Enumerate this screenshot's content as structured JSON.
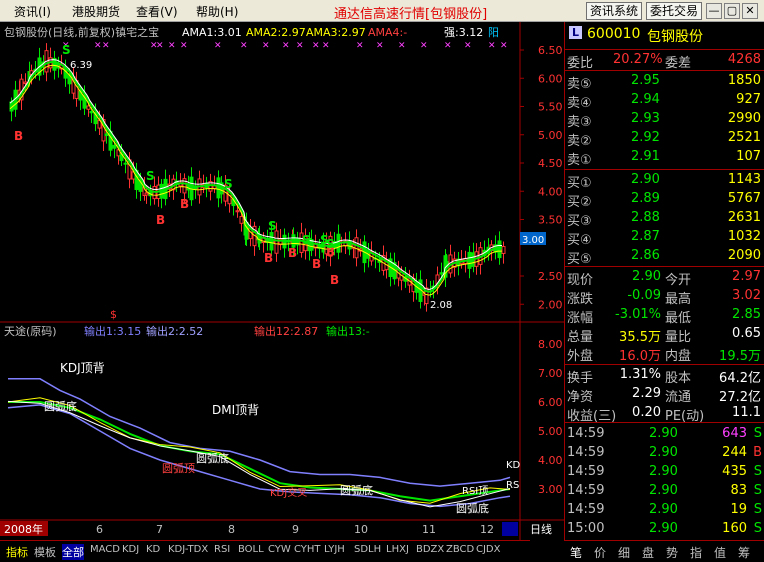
{
  "menubar": {
    "items": [
      "资讯(I)",
      "港股期货",
      "查看(V)",
      "帮助(H)"
    ],
    "app_title": "通达信高速行情[包钢股份]",
    "info_system_btn": "资讯系统",
    "trade_btn": "委托交易",
    "min_glyph": "—",
    "max_glyph": "▢",
    "close_glyph": "✕"
  },
  "chart": {
    "header_title": "包钢股份(日线,前复权)镇宅之宝",
    "ama1": "AMA1:3.01",
    "ama2": "AMA2:2.97",
    "ama3": "AMA3:2.97",
    "ama4": "AMA4:-",
    "strength": "强:3.12",
    "yang_label": "阳",
    "price_axis": [
      "6.50",
      "6.00",
      "5.50",
      "5.00",
      "4.50",
      "4.00",
      "3.50",
      "2.50",
      "2.00"
    ],
    "current_price_tag": "3.00",
    "high_label": "6.39",
    "low_label": "2.08",
    "buy_marker": "B",
    "sell_marker": "S",
    "dollar_marker": "$",
    "sub_title": "天途(原码)",
    "out1": "输出1:3.15",
    "out2": "输出2:2.52",
    "out12": "输出12:2.87",
    "out13": "输出13:-",
    "sub_axis": [
      "8.00",
      "7.00",
      "6.00",
      "5.00",
      "4.00",
      "3.00"
    ],
    "annotations": {
      "kdj_top": "KDJ顶背",
      "dmi_top": "DMI顶背",
      "arc_bottom": "圆弧底",
      "kd_label": "KD",
      "kdj_cross": "KDJ交叉",
      "arc_top": "圆弧顶",
      "rsi_label": "RSI顶",
      "back": "背",
      "rs": "RS"
    },
    "x_axis": [
      "2008年",
      "6",
      "7",
      "8",
      "9",
      "10",
      "11",
      "12"
    ],
    "day_line_label": "日线"
  },
  "quote": {
    "code": "600010",
    "name": "包钢股份",
    "logo": "L",
    "weibi_label": "委比",
    "weibi_value": "20.27%",
    "weicha_label": "委差",
    "weicha_value": "4268",
    "asks": [
      {
        "label": "卖⑤",
        "price": "2.95",
        "vol": "1850"
      },
      {
        "label": "卖④",
        "price": "2.94",
        "vol": "927"
      },
      {
        "label": "卖③",
        "price": "2.93",
        "vol": "2990"
      },
      {
        "label": "卖②",
        "price": "2.92",
        "vol": "2521"
      },
      {
        "label": "卖①",
        "price": "2.91",
        "vol": "107"
      }
    ],
    "bids": [
      {
        "label": "买①",
        "price": "2.90",
        "vol": "1143"
      },
      {
        "label": "买②",
        "price": "2.89",
        "vol": "5767"
      },
      {
        "label": "买③",
        "price": "2.88",
        "vol": "2631"
      },
      {
        "label": "买④",
        "price": "2.87",
        "vol": "1032"
      },
      {
        "label": "买⑤",
        "price": "2.86",
        "vol": "2090"
      }
    ],
    "stats": [
      {
        "l1": "现价",
        "v1": "2.90",
        "l2": "今开",
        "v2": "2.97"
      },
      {
        "l1": "涨跌",
        "v1": "-0.09",
        "l2": "最高",
        "v2": "3.02"
      },
      {
        "l1": "涨幅",
        "v1": "-3.01%",
        "l2": "最低",
        "v2": "2.85"
      },
      {
        "l1": "总量",
        "v1": "35.5万",
        "l2": "量比",
        "v2": "0.65"
      },
      {
        "l1": "外盘",
        "v1": "16.0万",
        "l2": "内盘",
        "v2": "19.5万"
      }
    ],
    "fund": [
      {
        "l1": "换手",
        "v1": "1.31%",
        "l2": "股本",
        "v2": "64.2亿"
      },
      {
        "l1": "净资",
        "v1": "2.29",
        "l2": "流通",
        "v2": "27.2亿"
      },
      {
        "l1": "收益(三)",
        "v1": "0.20",
        "l2": "PE(动)",
        "v2": "11.1"
      }
    ],
    "ticks": [
      {
        "time": "14:59",
        "price": "2.90",
        "vol": "643",
        "flag": "S"
      },
      {
        "time": "14:59",
        "price": "2.90",
        "vol": "244",
        "flag": "B"
      },
      {
        "time": "14:59",
        "price": "2.90",
        "vol": "435",
        "flag": "S"
      },
      {
        "time": "14:59",
        "price": "2.90",
        "vol": "83",
        "flag": "S"
      },
      {
        "time": "14:59",
        "price": "2.90",
        "vol": "19",
        "flag": "S"
      },
      {
        "time": "15:00",
        "price": "2.90",
        "vol": "160",
        "flag": "S"
      }
    ]
  },
  "bottom_tabs": [
    "指标",
    "模板",
    "全部",
    "MACD",
    "KDJ",
    "KD",
    "KDJ-TDX",
    "RSI",
    "BOLL",
    "CYW",
    "CYHT",
    "LYJH",
    "SDLH",
    "LHXJ",
    "BDZX",
    "ZBCD",
    "CJDX"
  ],
  "right_tabs": [
    "笔",
    "价",
    "细",
    "盘",
    "势",
    "指",
    "值",
    "筹"
  ],
  "colors": {
    "up": "#ff3232",
    "down": "#00e600",
    "text_yellow": "#ffff00",
    "axis_red": "#a00000"
  }
}
